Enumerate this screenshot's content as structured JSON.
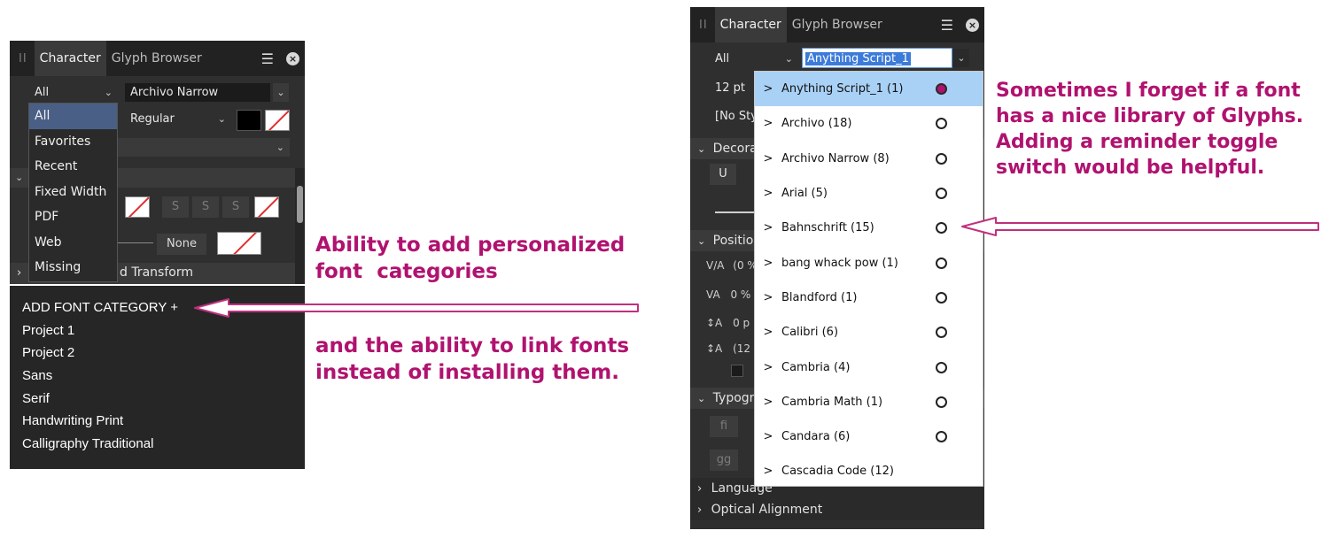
{
  "left_panel": {
    "grip": "II",
    "tabs": [
      "Character",
      "Glyph Browser"
    ],
    "collection_value": "All",
    "font_value": "Archivo Narrow",
    "style_value": "Regular",
    "collection_menu": [
      "All",
      "Favorites",
      "Recent",
      "Fixed Width",
      "PDF",
      "Web",
      "Missing"
    ],
    "strike_buttons": [
      "S",
      "S",
      "S"
    ],
    "none_label": "None",
    "transform_partial": "d Transform",
    "categories": {
      "add_label": "ADD FONT CATEGORY +",
      "items": [
        "Project 1",
        "Project 2",
        "Sans",
        "Serif",
        "Handwriting Print",
        "Calligraphy Traditional"
      ]
    }
  },
  "annotations": {
    "left_line1": "Ability to add personalized",
    "left_line2": "font  categories",
    "left_line3": "and the ability to link fonts",
    "left_line4": "instead of installing them.",
    "right_line1": "Sometimes I forget if a font",
    "right_line2": "has a nice library of Glyphs.",
    "right_line3": "Adding a reminder toggle",
    "right_line4": "switch would be helpful."
  },
  "right_panel": {
    "grip": "II",
    "tabs": [
      "Character",
      "Glyph Browser"
    ],
    "collection_value": "All",
    "font_value": "Anything Script_1",
    "size_value": "12 pt",
    "style_partial": "[No Sty",
    "section_decoration": "Decora",
    "underline_btn": "U",
    "section_position": "Positio",
    "pos_rows": [
      "(0 %",
      "0 %",
      "0 p",
      "(12"
    ],
    "section_typography": "Typogr",
    "typo_btns": [
      "fi",
      "gg"
    ],
    "fonts": [
      {
        "name": "Anything Script_1 (1)",
        "selected": true
      },
      {
        "name": "Archivo (18)",
        "selected": false
      },
      {
        "name": "Archivo Narrow (8)",
        "selected": false
      },
      {
        "name": "Arial (5)",
        "selected": false
      },
      {
        "name": "Bahnschrift (15)",
        "selected": false
      },
      {
        "name": "bang whack pow (1)",
        "selected": false
      },
      {
        "name": "Blandford (1)",
        "selected": false
      },
      {
        "name": "Calibri (6)",
        "selected": false
      },
      {
        "name": "Cambria (4)",
        "selected": false
      },
      {
        "name": "Cambria Math (1)",
        "selected": false
      },
      {
        "name": "Candara (6)",
        "selected": false
      },
      {
        "name": "Cascadia Code (12)",
        "selected": false
      }
    ],
    "bottom_sections": [
      "Language",
      "Optical Alignment"
    ]
  },
  "colors": {
    "annotation": "#b0126f",
    "selection_blue": "#a9d1f6"
  },
  "icons": {
    "menu": "hamburger-icon",
    "close": "close-circle-icon",
    "chevron": "chevron-down-icon",
    "expand": "chevron-right-icon"
  }
}
